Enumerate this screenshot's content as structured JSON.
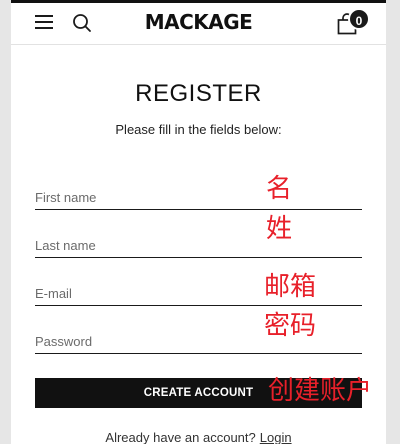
{
  "header": {
    "logo": "MACKAGE",
    "cart_count": "0",
    "icons": {
      "menu": "hamburger-menu-icon",
      "search": "search-icon",
      "cart": "shopping-bag-icon"
    }
  },
  "form": {
    "title": "REGISTER",
    "subtitle": "Please fill in the fields below:",
    "first_name": {
      "placeholder": "First name",
      "value": ""
    },
    "last_name": {
      "placeholder": "Last name",
      "value": ""
    },
    "email": {
      "placeholder": "E-mail",
      "value": ""
    },
    "password": {
      "placeholder": "Password",
      "value": ""
    },
    "submit_label": "CREATE ACCOUNT"
  },
  "footer": {
    "prompt": "Already have an account?",
    "login_label": "Login"
  },
  "annotations": {
    "first_name": "名",
    "last_name": "姓",
    "email": "邮箱",
    "password": "密码",
    "create_account": "创建账户"
  },
  "colors": {
    "accent": "#111111",
    "annotation": "#e8202a",
    "background": "#e6e6e6"
  }
}
